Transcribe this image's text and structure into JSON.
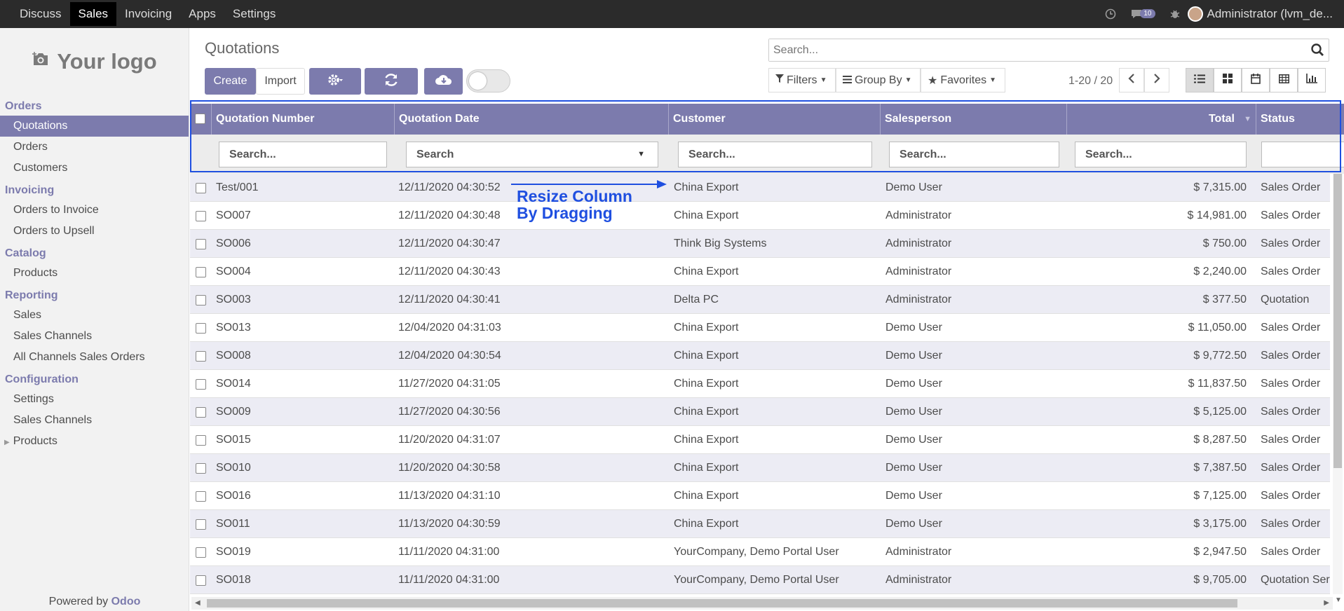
{
  "topbar": {
    "menu": [
      "Discuss",
      "Sales",
      "Invoicing",
      "Apps",
      "Settings"
    ],
    "active_menu": "Sales",
    "message_count": "10",
    "user": "Administrator (lvm_de..."
  },
  "sidebar": {
    "logo": "Your logo",
    "sections": [
      {
        "title": "Orders",
        "items": [
          "Quotations",
          "Orders",
          "Customers"
        ]
      },
      {
        "title": "Invoicing",
        "items": [
          "Orders to Invoice",
          "Orders to Upsell"
        ]
      },
      {
        "title": "Catalog",
        "items": [
          "Products"
        ]
      },
      {
        "title": "Reporting",
        "items": [
          "Sales",
          "Sales Channels",
          "All Channels Sales Orders"
        ]
      },
      {
        "title": "Configuration",
        "items": [
          "Settings",
          "Sales Channels",
          "Products"
        ]
      }
    ],
    "active_item": "Quotations",
    "powered_by": "Powered by",
    "powered_brand": "Odoo"
  },
  "page": {
    "title": "Quotations",
    "create_label": "Create",
    "import_label": "Import",
    "search_placeholder": "Search...",
    "filters_label": "Filters",
    "groupby_label": "Group By",
    "favorites_label": "Favorites",
    "pager": "1-20 / 20"
  },
  "table": {
    "headers": [
      "Quotation Number",
      "Quotation Date",
      "Customer",
      "Salesperson",
      "Total",
      "Status"
    ],
    "filter_placeholders": [
      "Search...",
      "Search",
      "Search...",
      "Search...",
      "Search...",
      ""
    ],
    "rows": [
      [
        "Test/001",
        "12/11/2020 04:30:52",
        "China Export",
        "Demo User",
        "$ 7,315.00",
        "Sales Order"
      ],
      [
        "SO007",
        "12/11/2020 04:30:48",
        "China Export",
        "Administrator",
        "$ 14,981.00",
        "Sales Order"
      ],
      [
        "SO006",
        "12/11/2020 04:30:47",
        "Think Big Systems",
        "Administrator",
        "$ 750.00",
        "Sales Order"
      ],
      [
        "SO004",
        "12/11/2020 04:30:43",
        "China Export",
        "Administrator",
        "$ 2,240.00",
        "Sales Order"
      ],
      [
        "SO003",
        "12/11/2020 04:30:41",
        "Delta PC",
        "Administrator",
        "$ 377.50",
        "Quotation"
      ],
      [
        "SO013",
        "12/04/2020 04:31:03",
        "China Export",
        "Demo User",
        "$ 11,050.00",
        "Sales Order"
      ],
      [
        "SO008",
        "12/04/2020 04:30:54",
        "China Export",
        "Demo User",
        "$ 9,772.50",
        "Sales Order"
      ],
      [
        "SO014",
        "11/27/2020 04:31:05",
        "China Export",
        "Demo User",
        "$ 11,837.50",
        "Sales Order"
      ],
      [
        "SO009",
        "11/27/2020 04:30:56",
        "China Export",
        "Demo User",
        "$ 5,125.00",
        "Sales Order"
      ],
      [
        "SO015",
        "11/20/2020 04:31:07",
        "China Export",
        "Demo User",
        "$ 8,287.50",
        "Sales Order"
      ],
      [
        "SO010",
        "11/20/2020 04:30:58",
        "China Export",
        "Demo User",
        "$ 7,387.50",
        "Sales Order"
      ],
      [
        "SO016",
        "11/13/2020 04:31:10",
        "China Export",
        "Demo User",
        "$ 7,125.00",
        "Sales Order"
      ],
      [
        "SO011",
        "11/13/2020 04:30:59",
        "China Export",
        "Demo User",
        "$ 3,175.00",
        "Sales Order"
      ],
      [
        "SO019",
        "11/11/2020 04:31:00",
        "YourCompany, Demo Portal User",
        "Administrator",
        "$ 2,947.50",
        "Sales Order"
      ],
      [
        "SO018",
        "11/11/2020 04:31:00",
        "YourCompany, Demo Portal User",
        "Administrator",
        "$ 9,705.00",
        "Quotation Ser"
      ]
    ]
  },
  "annotation": {
    "line1": "Resize Column",
    "line2": "By Dragging"
  },
  "colors": {
    "brand": "#7c7bad",
    "annotation": "#1f4fe0"
  }
}
